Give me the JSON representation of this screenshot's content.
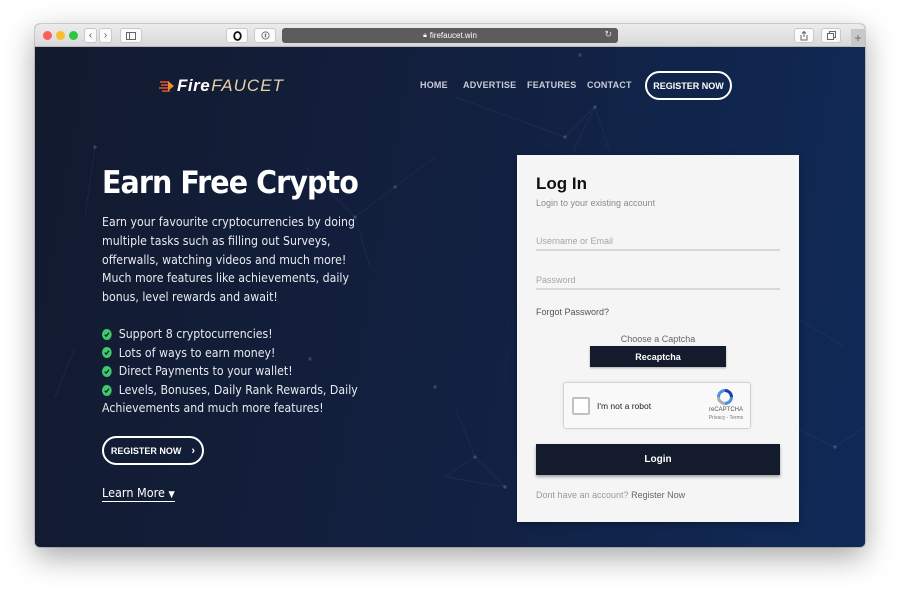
{
  "browser": {
    "url": "firefaucet.win",
    "lock_icon": "lock-icon",
    "buttons": [
      "back-icon",
      "forward-icon",
      "sidebar-icon",
      "opera-icon",
      "password-icon",
      "reload-icon",
      "share-icon",
      "tabs-icon",
      "new-tab-icon"
    ],
    "new_tab_label": "+"
  },
  "header": {
    "logo_fire": "Fire",
    "logo_faucet": "FAUCET",
    "nav": [
      "HOME",
      "ADVERTISE",
      "FEATURES",
      "CONTACT"
    ],
    "register_label": "REGISTER NOW"
  },
  "hero": {
    "title": "Earn Free Crypto",
    "description": "Earn your favourite cryptocurrencies by doing multiple tasks such as filling out Surveys, offerwalls, watching videos and much more! Much more features like achievements, daily bonus, level rewards and await!",
    "features": [
      "Support 8 cryptocurrencies!",
      "Lots of ways to earn money!",
      "Direct Payments to your wallet!",
      "Levels, Bonuses, Daily Rank Rewards, Daily"
    ],
    "features_continuation": "Achievements and much more features!",
    "register_label": "REGISTER NOW",
    "register_chevron": "›",
    "learn_more_label": "Learn More",
    "learn_more_chevron": "⌄"
  },
  "login": {
    "title": "Log In",
    "subtitle": "Login to your existing account",
    "username_placeholder": "Username or Email",
    "username_value": "",
    "password_placeholder": "Password",
    "password_value": "",
    "forgot_label": "Forgot Password?",
    "captcha_label": "Choose a Captcha",
    "captcha_option": "Recaptcha",
    "recaptcha": {
      "checkbox_label": "I'm not a robot",
      "brand": "reCAPTCHA",
      "links": "Privacy - Terms"
    },
    "login_button": "Login",
    "signup_prompt": "Dont have an account?",
    "signup_link": "Register Now"
  },
  "colors": {
    "accent_dark": "#141b2d",
    "check_green": "#3fca6b",
    "logo_gold": "#e6d3a8",
    "page_bg_left": "#121a2e",
    "page_bg_right": "#0f2a58"
  }
}
